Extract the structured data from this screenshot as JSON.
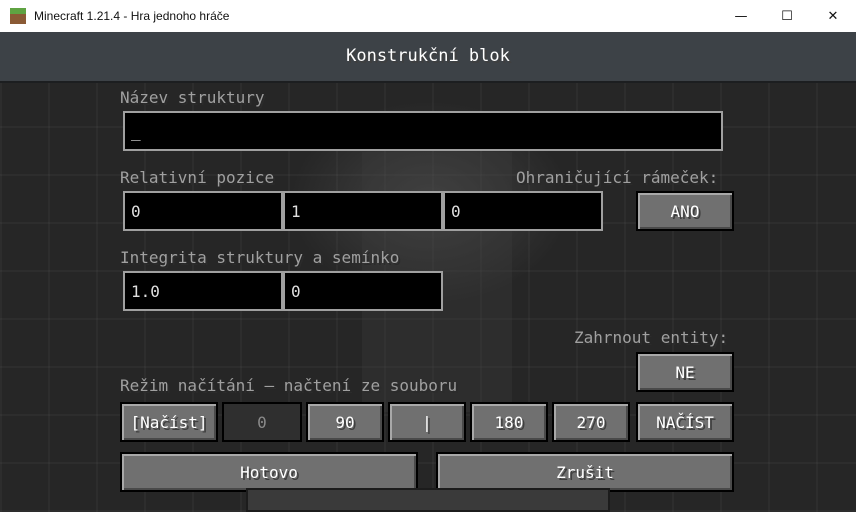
{
  "window": {
    "title": "Minecraft 1.21.4 - Hra jednoho hráče",
    "minimize_glyph": "—",
    "maximize_glyph": "☐",
    "close_glyph": "✕"
  },
  "screen": {
    "title": "Konstrukční blok"
  },
  "structure_name": {
    "label": "Název struktury",
    "value": "_"
  },
  "relative_position": {
    "label": "Relativní pozice",
    "x": "0",
    "y": "1",
    "z": "0"
  },
  "bounding_box": {
    "label": "Ohraničující rámeček:",
    "button": "ANO"
  },
  "integrity": {
    "label": "Integrita struktury a semínko",
    "integrity_value": "1.0",
    "seed_value": "0"
  },
  "include_entities": {
    "label": "Zahrnout entity:",
    "button": "NE"
  },
  "mode": {
    "label": "Režim načítání — načtení ze souboru",
    "mode_button": "[Načíst]",
    "rotation_0": "0",
    "rotation_90": "90",
    "mirror": "|",
    "rotation_180": "180",
    "rotation_270": "270",
    "load_button": "NAČÍST"
  },
  "actions": {
    "done": "Hotovo",
    "cancel": "Zrušit"
  }
}
